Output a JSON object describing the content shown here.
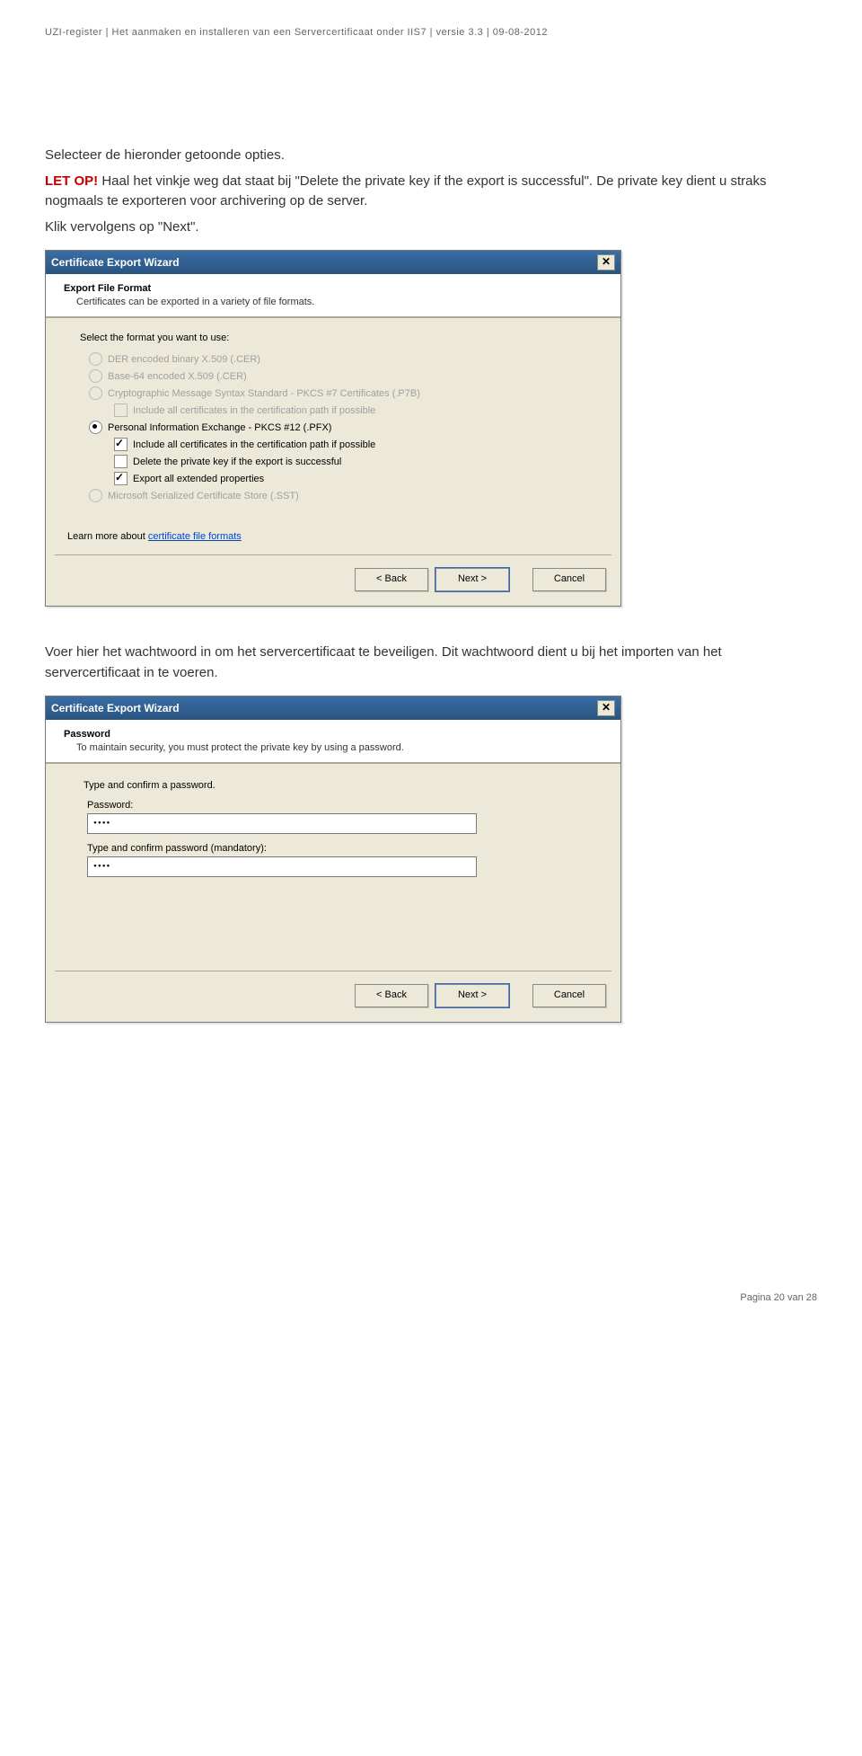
{
  "header_meta": "UZI-register | Het aanmaken en installeren van een Servercertificaat onder IIS7 | versie 3.3 | 09-08-2012",
  "intro": {
    "line1": "Selecteer de hieronder getoonde opties.",
    "warn_label": "LET OP!",
    "line2a": " Haal het vinkje weg dat staat bij \"Delete the private key if the export is successful\". De private key dient u straks nogmaals te exporteren voor archivering op de server.",
    "line3": "Klik vervolgens op \"Next\"."
  },
  "dialog1": {
    "title": "Certificate Export Wizard",
    "h1": "Export File Format",
    "h2": "Certificates can be exported in a variety of file formats.",
    "intro": "Select the format you want to use:",
    "opt_der": "DER encoded binary X.509 (.CER)",
    "opt_b64": "Base-64 encoded X.509 (.CER)",
    "opt_pkcs7": "Cryptographic Message Syntax Standard - PKCS #7 Certificates (.P7B)",
    "opt_pkcs7_sub": "Include all certificates in the certification path if possible",
    "opt_pfx": "Personal Information Exchange - PKCS #12 (.PFX)",
    "opt_pfx_sub1": "Include all certificates in the certification path if possible",
    "opt_pfx_sub2": "Delete the private key if the export is successful",
    "opt_pfx_sub3": "Export all extended properties",
    "opt_sst": "Microsoft Serialized Certificate Store (.SST)",
    "learn_prefix": "Learn more about ",
    "learn_link": "certificate file formats",
    "btn_back": "< Back",
    "btn_next": "Next >",
    "btn_cancel": "Cancel"
  },
  "mid_text": {
    "line1": "Voer hier het wachtwoord in om het servercertificaat te beveiligen. Dit wachtwoord dient u bij het importen van het servercertificaat in te voeren."
  },
  "dialog2": {
    "title": "Certificate Export Wizard",
    "h1": "Password",
    "h2": "To maintain security, you must protect the private key by using a password.",
    "intro": "Type and confirm a password.",
    "lbl_pw": "Password:",
    "lbl_cf": "Type and confirm password (mandatory):",
    "mask": "••••",
    "btn_back": "< Back",
    "btn_next": "Next >",
    "btn_cancel": "Cancel"
  },
  "footer": "Pagina 20 van 28"
}
